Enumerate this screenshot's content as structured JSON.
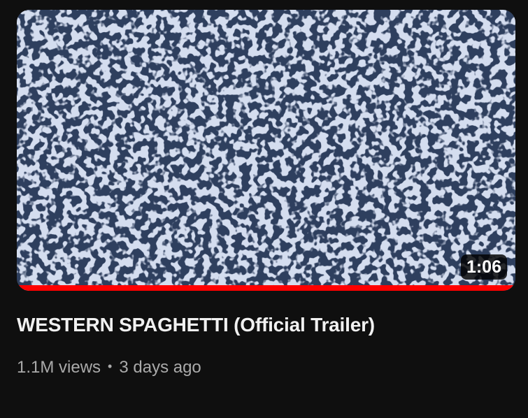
{
  "video": {
    "title": "WESTERN SPAGHETTI (Official Trailer)",
    "duration": "1:06",
    "views": "1.1M views",
    "separator": "•",
    "age": "3 days ago",
    "watched_fraction": 1.0,
    "thumbnail": "tv-static-noise",
    "colors": {
      "background": "#0f0f0f",
      "progress": "#ff0000",
      "static_dark": "#2e3f5e",
      "static_light": "#a8b8dc",
      "title": "#f1f1f1",
      "meta": "#aaaaaa"
    }
  }
}
